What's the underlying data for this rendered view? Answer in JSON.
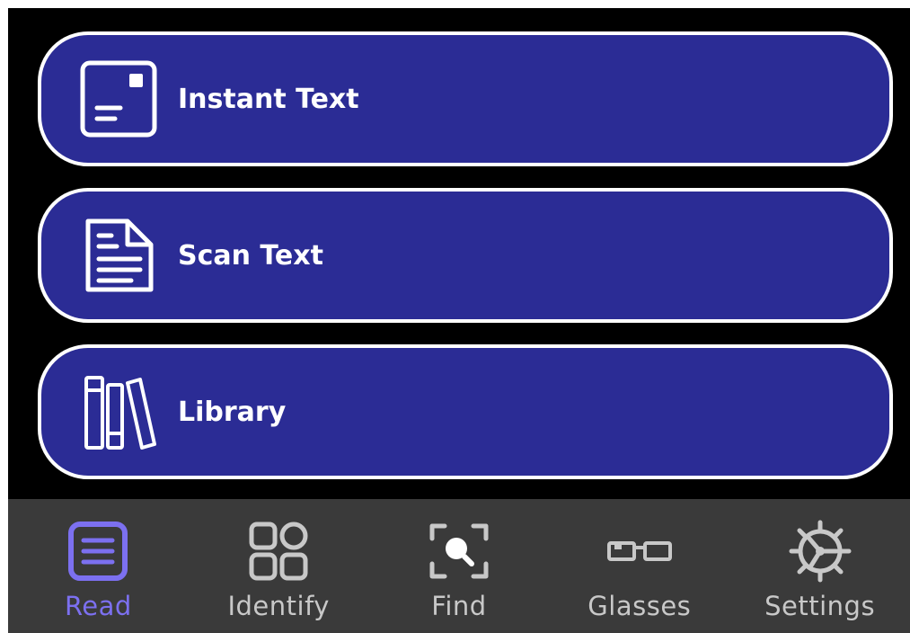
{
  "menu": {
    "items": [
      {
        "label": "Instant Text",
        "icon": "instant-text-icon"
      },
      {
        "label": "Scan Text",
        "icon": "document-icon"
      },
      {
        "label": "Library",
        "icon": "books-icon"
      }
    ]
  },
  "tabbar": {
    "active": "Read",
    "tabs": [
      {
        "label": "Read",
        "icon": "read-icon"
      },
      {
        "label": "Identify",
        "icon": "grid-icon"
      },
      {
        "label": "Find",
        "icon": "find-icon"
      },
      {
        "label": "Glasses",
        "icon": "glasses-icon"
      },
      {
        "label": "Settings",
        "icon": "gear-icon"
      }
    ]
  },
  "colors": {
    "background": "#000000",
    "button_fill": "#2b2c95",
    "button_border": "#ffffff",
    "tabbar_bg": "#3a3a3a",
    "tab_active": "#7c70f0",
    "tab_inactive": "#c8c8c8"
  }
}
